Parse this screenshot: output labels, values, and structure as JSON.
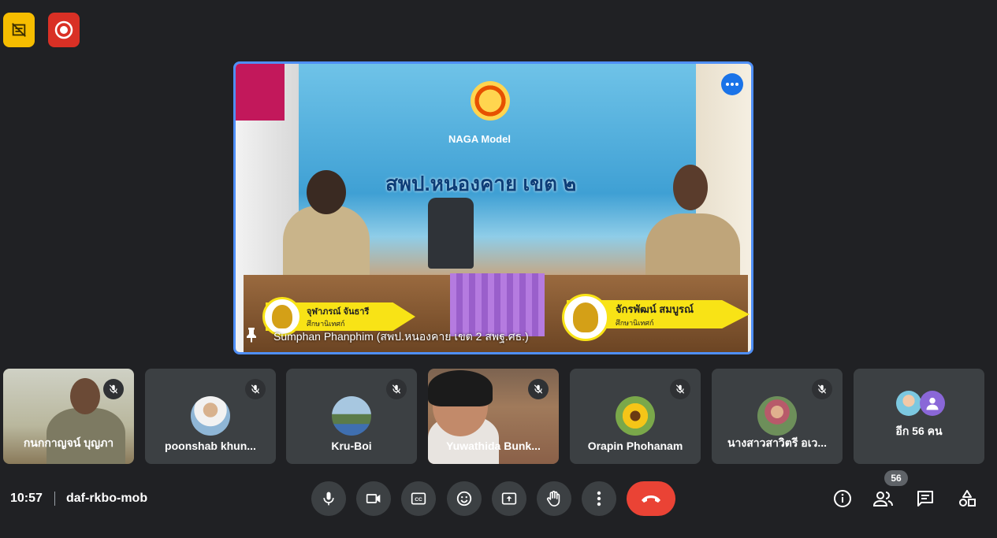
{
  "main": {
    "presenter_caption": "Sumphan Phanphim (สพป.หนองคาย เขต 2 สพฐ.ศธ.)",
    "banner_title": "สพป.หนองคาย เขต ๒",
    "banner_logo_text": "NAGA Model",
    "nameplate_left": {
      "name": "จุฬาภรณ์ จันธารี",
      "role": "ศึกษานิเทศก์"
    },
    "nameplate_right": {
      "name": "จักรพัฒน์ สมบูรณ์",
      "role": "ศึกษานิเทศก์"
    }
  },
  "participants": [
    {
      "name": "กนกกาญจน์ บุญภา",
      "muted": true
    },
    {
      "name": "poonshab khun...",
      "muted": true
    },
    {
      "name": "Kru-Boi",
      "muted": true
    },
    {
      "name": "Yuwathida Bunk...",
      "muted": true
    },
    {
      "name": "Orapin Phohanam",
      "muted": true
    },
    {
      "name": "นางสาวสาวิตรี อเว...",
      "muted": true
    }
  ],
  "more_participants_label": "อีก 56 คน",
  "bottom_bar": {
    "time": "10:57",
    "meeting_code": "daf-rkbo-mob",
    "people_count": "56"
  },
  "colors": {
    "background": "#202124",
    "tile": "#3c4043",
    "end_call": "#ea4335",
    "active_border": "#4f8ff7",
    "recording": "#d93025",
    "doc_badge": "#f6bd00"
  }
}
